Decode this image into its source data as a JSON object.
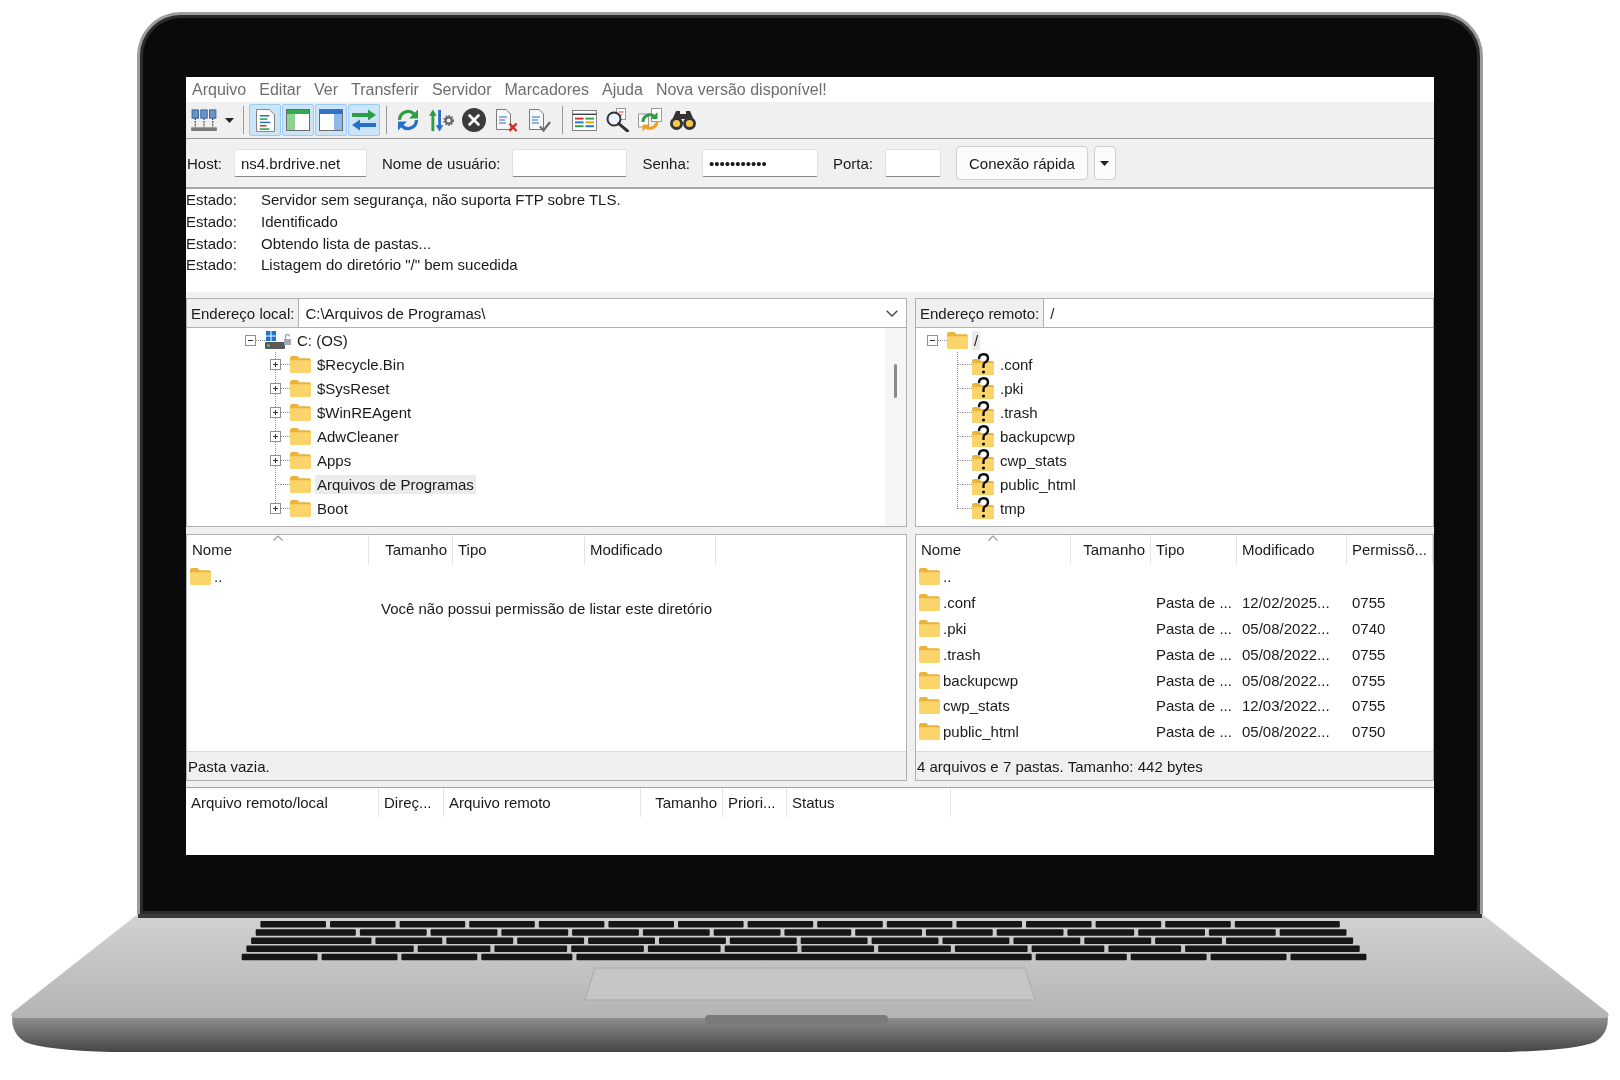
{
  "menu": [
    "Arquivo",
    "Editar",
    "Ver",
    "Transferir",
    "Servidor",
    "Marcadores",
    "Ajuda",
    "Nova versão disponível!"
  ],
  "toolbar": {
    "toggles": [
      {
        "selected": true
      },
      {
        "selected": true
      },
      {
        "selected": true
      },
      {
        "selected": true
      }
    ]
  },
  "quickconnect": {
    "fields": [
      {
        "label": "Host:",
        "value": "ns4.brdrive.net"
      },
      {
        "label": "Nome de usuário:"
      },
      {
        "label": "Senha:",
        "value": "•••••••••••"
      },
      {
        "label": "Porta:"
      }
    ],
    "button": "Conexão rápida"
  },
  "message_log": [
    {
      "label": "Estado:",
      "text": "Servidor sem segurança, não suporta FTP sobre TLS."
    },
    {
      "label": "Estado:",
      "text": "Identificado"
    },
    {
      "label": "Estado:",
      "text": "Obtendo lista de pastas..."
    },
    {
      "label": "Estado:",
      "text": "Listagem do diretório \"/\" bem sucedida"
    }
  ],
  "local": {
    "address_label": "Endereço local:",
    "address": "C:\\Arquivos de Programas\\",
    "dropdown": true,
    "tree": [
      {
        "label": "C: (OS)",
        "kind": "drive",
        "expanded": true,
        "selected": false,
        "children": [
          {
            "label": "$Recycle.Bin",
            "kind": "folder",
            "expanded": false,
            "selected": false
          },
          {
            "label": "$SysReset",
            "kind": "folder",
            "expanded": false,
            "selected": false
          },
          {
            "label": "$WinREAgent",
            "kind": "folder",
            "expanded": false,
            "selected": false
          },
          {
            "label": "AdwCleaner",
            "kind": "folder",
            "expanded": false,
            "selected": false
          },
          {
            "label": "Apps",
            "kind": "folder",
            "expanded": false,
            "selected": false
          },
          {
            "label": "Arquivos de Programas",
            "kind": "folder",
            "selected": true
          },
          {
            "label": "Boot",
            "kind": "folder",
            "expanded": false,
            "selected": false
          }
        ]
      }
    ],
    "list": {
      "columns": [
        {
          "label": "Nome",
          "sorted": true
        },
        {
          "label": "Tamanho",
          "sorted": false
        },
        {
          "label": "Tipo",
          "sorted": false
        },
        {
          "label": "Modificado",
          "sorted": false
        }
      ],
      "rows": [
        {
          "name": ".."
        }
      ],
      "message": "Você não possui permissão de listar este diretório",
      "status": "Pasta vazia."
    }
  },
  "remote": {
    "address_label": "Endereço remoto:",
    "address": "/",
    "dropdown": false,
    "tree": [
      {
        "label": "/",
        "kind": "folder",
        "expanded": true,
        "selected": true,
        "children": [
          {
            "label": ".conf",
            "kind": "unknown-folder",
            "selected": false
          },
          {
            "label": ".pki",
            "kind": "unknown-folder",
            "selected": false
          },
          {
            "label": ".trash",
            "kind": "unknown-folder",
            "selected": false
          },
          {
            "label": "backupcwp",
            "kind": "unknown-folder",
            "selected": false
          },
          {
            "label": "cwp_stats",
            "kind": "unknown-folder",
            "selected": false
          },
          {
            "label": "public_html",
            "kind": "unknown-folder",
            "selected": false
          },
          {
            "label": "tmp",
            "kind": "unknown-folder",
            "selected": false
          }
        ]
      }
    ],
    "list": {
      "columns": [
        {
          "label": "Nome",
          "sorted": true
        },
        {
          "label": "Tamanho",
          "sorted": false
        },
        {
          "label": "Tipo",
          "sorted": false
        },
        {
          "label": "Modificado",
          "sorted": false
        },
        {
          "label": "Permissõ...",
          "sorted": false
        }
      ],
      "rows": [
        {
          "name": ".."
        },
        {
          "name": ".conf",
          "type": "Pasta de ...",
          "modified": "12/02/2025...",
          "permissions": "0755"
        },
        {
          "name": ".pki",
          "type": "Pasta de ...",
          "modified": "05/08/2022...",
          "permissions": "0740"
        },
        {
          "name": ".trash",
          "type": "Pasta de ...",
          "modified": "05/08/2022...",
          "permissions": "0755"
        },
        {
          "name": "backupcwp",
          "type": "Pasta de ...",
          "modified": "05/08/2022...",
          "permissions": "0755"
        },
        {
          "name": "cwp_stats",
          "type": "Pasta de ...",
          "modified": "12/03/2022...",
          "permissions": "0755"
        },
        {
          "name": "public_html",
          "type": "Pasta de ...",
          "modified": "05/08/2022...",
          "permissions": "0750"
        }
      ],
      "status": "4 arquivos e 7 pastas. Tamanho: 442 bytes"
    }
  },
  "queue": {
    "columns": [
      "Arquivo remoto/local",
      "Direç...",
      "Arquivo remoto",
      "Tamanho",
      "Priori...",
      "Status"
    ]
  }
}
